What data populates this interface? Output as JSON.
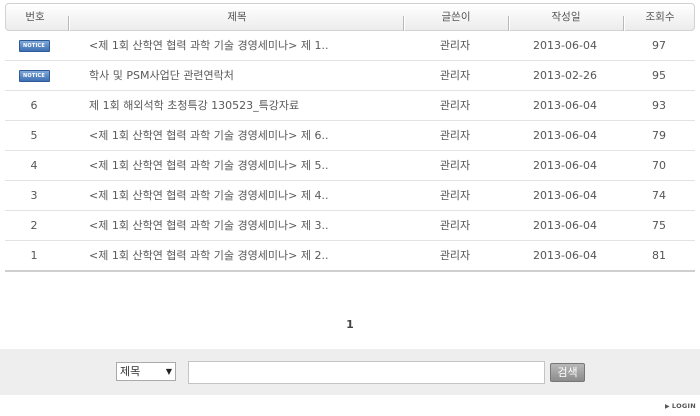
{
  "header": {
    "num": "번호",
    "title": "제목",
    "author": "글쓴이",
    "date": "작성일",
    "views": "조회수"
  },
  "notice_label": "NOTICE",
  "rows": [
    {
      "num": "",
      "notice": true,
      "title": "<제 1회 산학연 협력 과학 기술 경영세미나> 제 1..",
      "author": "관리자",
      "date": "2013-06-04",
      "views": "97"
    },
    {
      "num": "",
      "notice": true,
      "title": "학사 및 PSM사업단 관련연락처",
      "author": "관리자",
      "date": "2013-02-26",
      "views": "95"
    },
    {
      "num": "6",
      "notice": false,
      "title": "제 1회 해외석학 초청특강 130523_특강자료",
      "author": "관리자",
      "date": "2013-06-04",
      "views": "93"
    },
    {
      "num": "5",
      "notice": false,
      "title": "<제 1회 산학연 협력 과학 기술 경영세미나> 제 6..",
      "author": "관리자",
      "date": "2013-06-04",
      "views": "79"
    },
    {
      "num": "4",
      "notice": false,
      "title": "<제 1회 산학연 협력 과학 기술 경영세미나> 제 5..",
      "author": "관리자",
      "date": "2013-06-04",
      "views": "70"
    },
    {
      "num": "3",
      "notice": false,
      "title": "<제 1회 산학연 협력 과학 기술 경영세미나> 제 4..",
      "author": "관리자",
      "date": "2013-06-04",
      "views": "74"
    },
    {
      "num": "2",
      "notice": false,
      "title": "<제 1회 산학연 협력 과학 기술 경영세미나> 제 3..",
      "author": "관리자",
      "date": "2013-06-04",
      "views": "75"
    },
    {
      "num": "1",
      "notice": false,
      "title": "<제 1회 산학연 협력 과학 기술 경영세미나> 제 2..",
      "author": "관리자",
      "date": "2013-06-04",
      "views": "81"
    }
  ],
  "pagination": {
    "current": "1"
  },
  "search": {
    "field_selected": "제목",
    "query_value": "",
    "button_label": "검색"
  },
  "footer": {
    "login_label": "LOGIN"
  }
}
